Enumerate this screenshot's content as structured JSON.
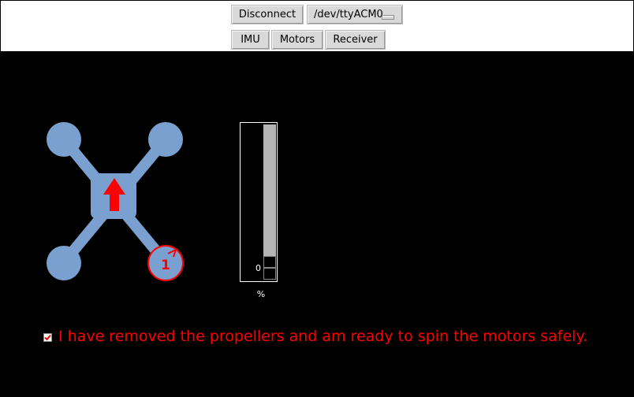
{
  "toolbar": {
    "disconnect_label": "Disconnect",
    "port_value": "/dev/ttyACM0",
    "tabs": [
      {
        "label": "IMU"
      },
      {
        "label": "Motors"
      },
      {
        "label": "Receiver"
      }
    ]
  },
  "motors": {
    "selected_motor_label": "1",
    "gauge_value_label": "0",
    "gauge_unit": "%",
    "gauge_value": 0
  },
  "safety": {
    "checked": true,
    "label": "I have removed the propellers and am ready to spin the motors safely."
  },
  "colors": {
    "frame": "#7aa0d0",
    "accent": "#ff0000",
    "canvas_bg": "#000000"
  }
}
